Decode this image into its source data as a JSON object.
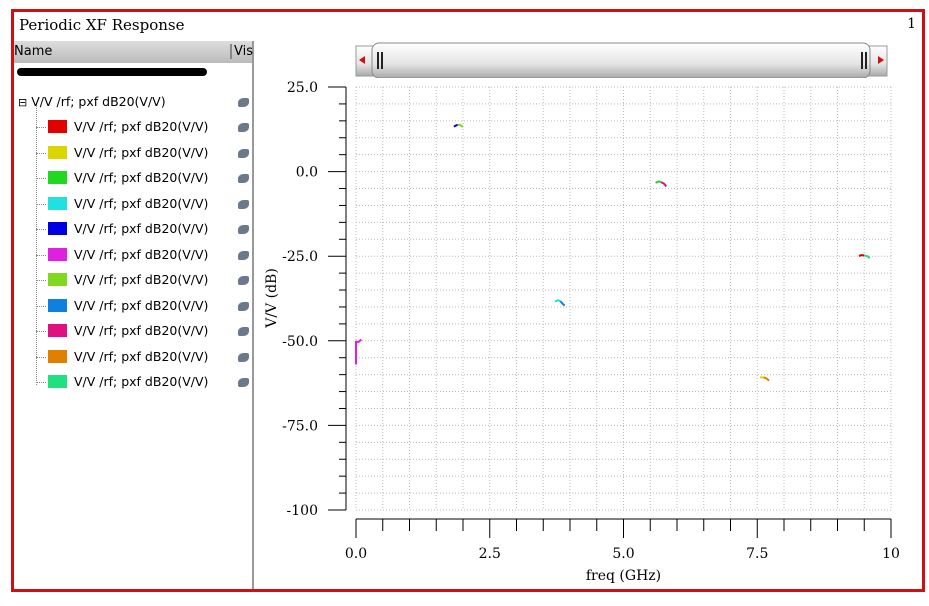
{
  "window": {
    "title": "Periodic XF Response",
    "subwindow_number": "1"
  },
  "panel": {
    "col_name": "Name",
    "col_vis": "Vis",
    "group_label": "V/V /rf; pxf dB20(V/V)",
    "items": [
      {
        "label": "V/V /rf; pxf dB20(V/V)",
        "color": "#e00000"
      },
      {
        "label": "V/V /rf; pxf dB20(V/V)",
        "color": "#d8d800"
      },
      {
        "label": "V/V /rf; pxf dB20(V/V)",
        "color": "#20d820"
      },
      {
        "label": "V/V /rf; pxf dB20(V/V)",
        "color": "#20e0e0"
      },
      {
        "label": "V/V /rf; pxf dB20(V/V)",
        "color": "#0000e0"
      },
      {
        "label": "V/V /rf; pxf dB20(V/V)",
        "color": "#e020e0"
      },
      {
        "label": "V/V /rf; pxf dB20(V/V)",
        "color": "#80d820"
      },
      {
        "label": "V/V /rf; pxf dB20(V/V)",
        "color": "#1080e0"
      },
      {
        "label": "V/V /rf; pxf dB20(V/V)",
        "color": "#e01080"
      },
      {
        "label": "V/V /rf; pxf dB20(V/V)",
        "color": "#e08000"
      },
      {
        "label": "V/V /rf; pxf dB20(V/V)",
        "color": "#20e080"
      }
    ]
  },
  "chart_data": {
    "type": "line",
    "xlabel": "freq (GHz)",
    "ylabel": "V/V (dB)",
    "xlim": [
      0,
      10
    ],
    "ylim": [
      -100,
      25
    ],
    "grid": true,
    "xticks": [
      "0.0",
      "2.5",
      "5.0",
      "7.5",
      "10"
    ],
    "xtick_values": [
      0,
      2.5,
      5,
      7.5,
      10
    ],
    "yticks": [
      "25.0",
      "0.0",
      "-25.0",
      "-50.0",
      "-75.0",
      "-100"
    ],
    "ytick_values": [
      25,
      0,
      -25,
      -50,
      -75,
      -100
    ],
    "series": [
      {
        "color": "#e00000",
        "points": [
          [
            9.4,
            -24.9
          ],
          [
            9.45,
            -24.7
          ],
          [
            9.5,
            -24.8
          ]
        ]
      },
      {
        "color": "#d8d800",
        "points": [
          [
            7.55,
            -60.8
          ],
          [
            7.62,
            -60.8
          ]
        ]
      },
      {
        "color": "#20d820",
        "points": [
          [
            5.6,
            -3.3
          ],
          [
            5.66,
            -2.9
          ],
          [
            5.7,
            -3.1
          ]
        ]
      },
      {
        "color": "#20e0e0",
        "points": [
          [
            3.72,
            -38.4
          ],
          [
            3.78,
            -38.0
          ],
          [
            3.82,
            -38.3
          ]
        ]
      },
      {
        "color": "#0000e0",
        "points": [
          [
            1.83,
            13.3
          ],
          [
            1.88,
            13.7
          ],
          [
            1.9,
            13.8
          ]
        ]
      },
      {
        "color": "#e020e0",
        "points": [
          [
            0.0,
            -57
          ],
          [
            0.0,
            -50.3
          ],
          [
            0.05,
            -50.3
          ],
          [
            0.1,
            -49.6
          ]
        ]
      },
      {
        "color": "#80d820",
        "points": [
          [
            1.9,
            13.8
          ],
          [
            1.95,
            13.8
          ],
          [
            2.0,
            13.2
          ]
        ]
      },
      {
        "color": "#1080e0",
        "points": [
          [
            3.82,
            -38.3
          ],
          [
            3.86,
            -39.0
          ],
          [
            3.9,
            -39.6
          ]
        ]
      },
      {
        "color": "#e01080",
        "points": [
          [
            5.7,
            -3.1
          ],
          [
            5.76,
            -3.6
          ],
          [
            5.8,
            -4.4
          ]
        ]
      },
      {
        "color": "#e08000",
        "points": [
          [
            7.62,
            -60.8
          ],
          [
            7.68,
            -61.2
          ],
          [
            7.72,
            -61.8
          ]
        ]
      },
      {
        "color": "#20e080",
        "points": [
          [
            9.5,
            -24.8
          ],
          [
            9.56,
            -25.0
          ],
          [
            9.6,
            -25.6
          ]
        ]
      }
    ]
  }
}
